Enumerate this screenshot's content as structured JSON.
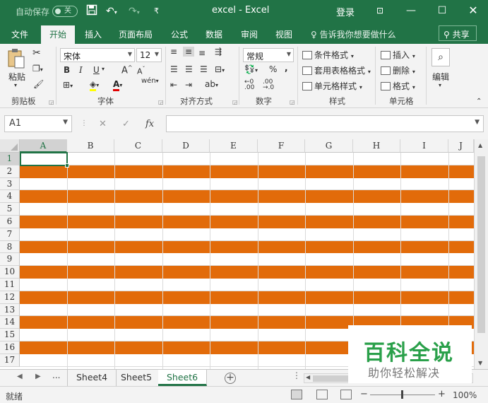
{
  "titlebar": {
    "autosave_label": "自动保存",
    "autosave_state": "关",
    "title": "excel  -  Excel",
    "login": "登录",
    "icons": [
      "save-icon",
      "undo-icon",
      "redo-icon",
      "customize-icon",
      "ribbon-display-icon",
      "minimize-icon",
      "maximize-icon",
      "close-icon"
    ]
  },
  "ribbon_tabs": {
    "items": [
      "文件",
      "开始",
      "插入",
      "页面布局",
      "公式",
      "数据",
      "审阅",
      "视图"
    ],
    "active": "开始",
    "tell_me": "告诉我你想要做什么",
    "share": "共享"
  },
  "ribbon": {
    "clipboard": {
      "label": "剪贴板",
      "paste": "粘贴"
    },
    "font": {
      "label": "字体",
      "name": "宋体",
      "size": "12",
      "bold": "B",
      "italic": "I",
      "underline": "U",
      "grow": "A",
      "shrink": "A",
      "wen": "wén"
    },
    "alignment": {
      "label": "对齐方式"
    },
    "number": {
      "label": "数字",
      "format": "常规",
      "percent": "%",
      "comma": ","
    },
    "styles": {
      "label": "样式",
      "conditional": "条件格式",
      "table": "套用表格格式",
      "cell": "单元格样式"
    },
    "cells": {
      "label": "单元格",
      "insert": "插入",
      "delete": "删除",
      "format": "格式"
    },
    "editing": {
      "label": "编辑"
    }
  },
  "formula_bar": {
    "name_box": "A1",
    "value": "",
    "fx": "fx"
  },
  "grid": {
    "columns": [
      "A",
      "B",
      "C",
      "D",
      "E",
      "F",
      "G",
      "H",
      "I",
      "J"
    ],
    "rows": [
      "1",
      "2",
      "3",
      "4",
      "5",
      "6",
      "7",
      "8",
      "9",
      "10",
      "11",
      "12",
      "13",
      "14",
      "15",
      "16",
      "17"
    ],
    "band_color": "#E26B0A",
    "selected_cell": "A1"
  },
  "sheets": {
    "items": [
      "Sheet4",
      "Sheet5",
      "Sheet6"
    ],
    "active": "Sheet6",
    "ellipsis": "..."
  },
  "status": {
    "ready": "就绪",
    "zoom": "100%"
  },
  "watermark": {
    "main": "百科全说",
    "sub": "助你轻松解决"
  },
  "accent": "#217346"
}
